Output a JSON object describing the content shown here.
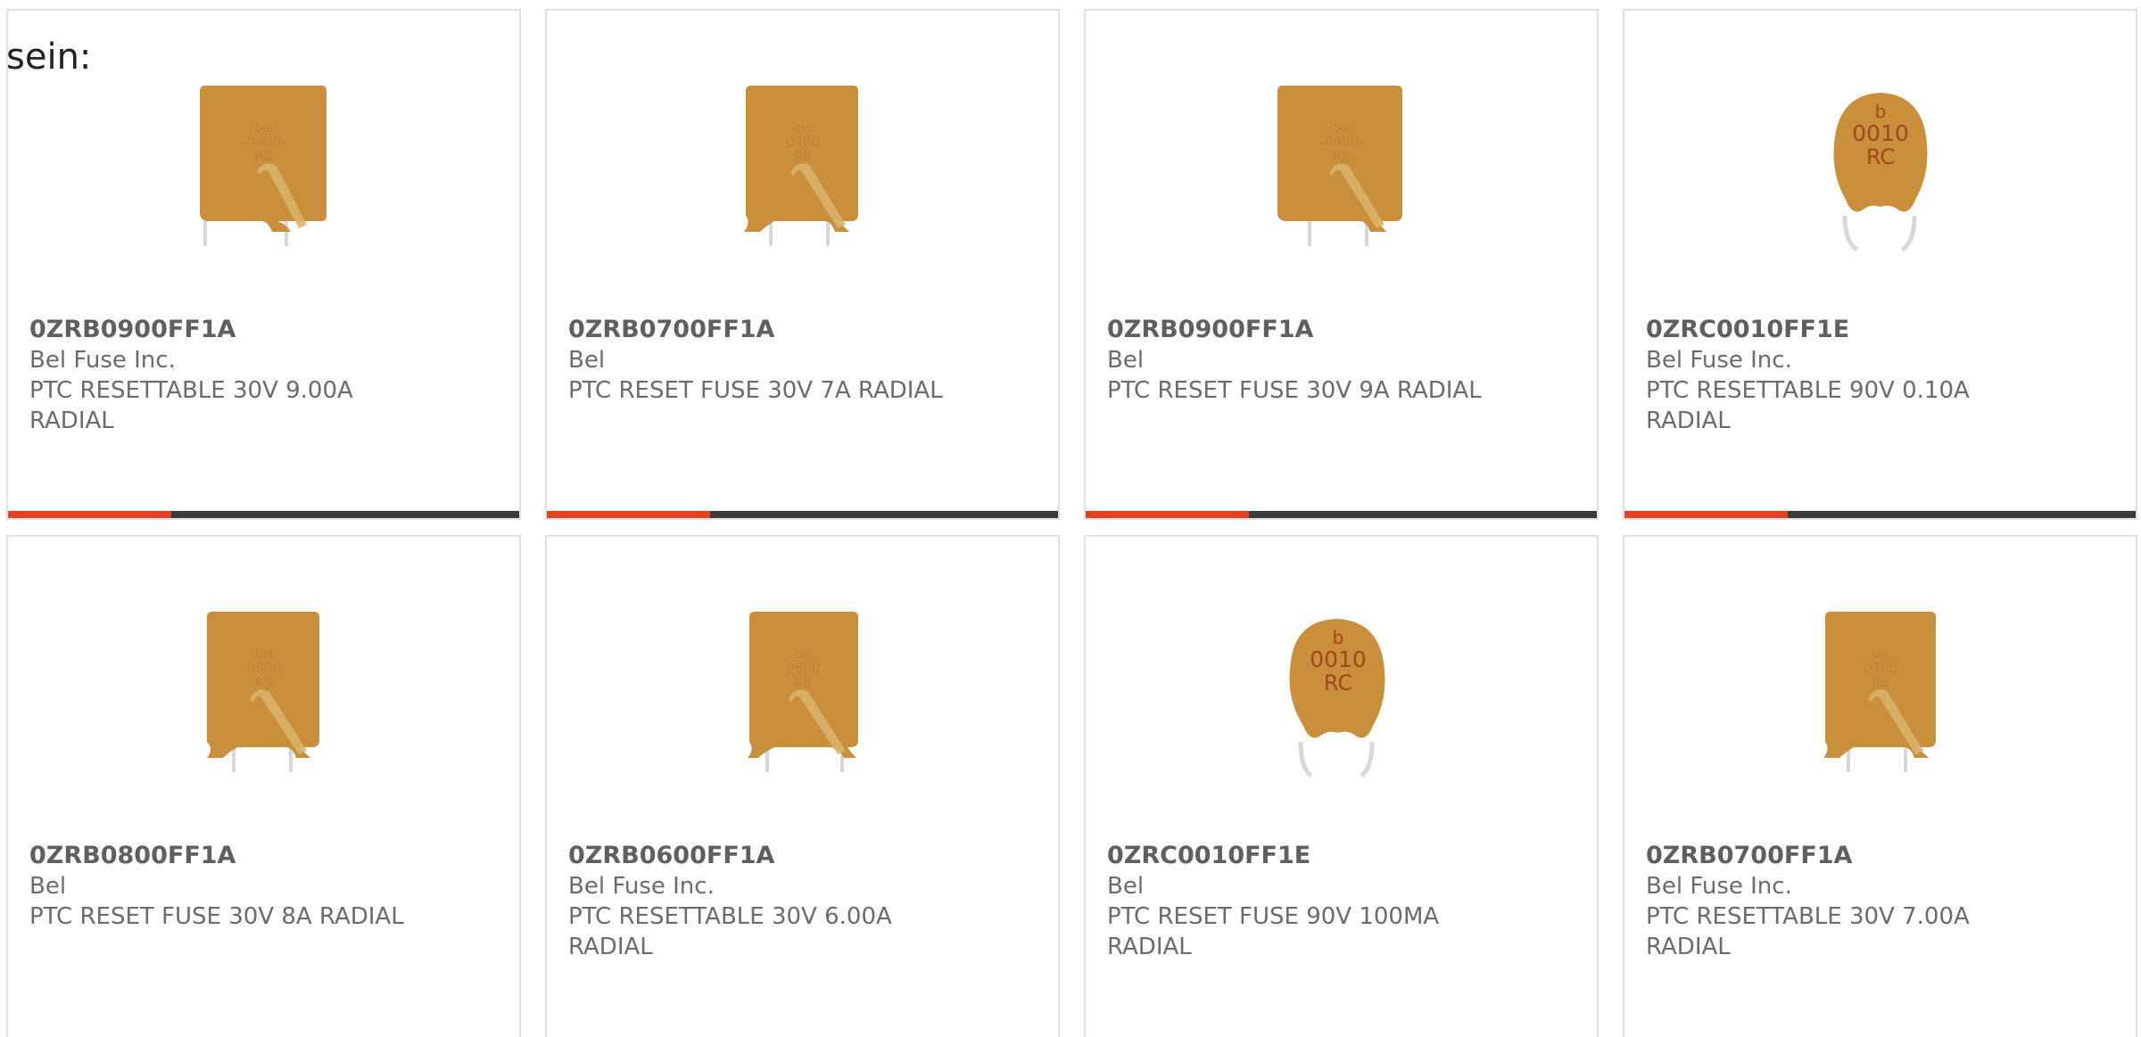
{
  "intro": {
    "text": "sein:"
  },
  "theme": {
    "accent": "#e7411d",
    "bar_dark": "#3b3b3b",
    "card_border": "#e0e0e0",
    "text_dark": "#5f5f5f",
    "text_muted": "#6b6b6b",
    "fuse_body": "#c98f3a"
  },
  "products": [
    {
      "part_number": "0ZRB0900FF1A",
      "manufacturer": "Bel Fuse Inc.",
      "description": "PTC RESETTABLE 30V 9.00A RADIAL",
      "image_icon": "rectangular-fuse-icon",
      "image_marking": [
        "bel",
        "0900",
        "RB"
      ],
      "progress": 0.32
    },
    {
      "part_number": "0ZRB0700FF1A",
      "manufacturer": "Bel",
      "description": "PTC RESET FUSE 30V 7A RADIAL",
      "image_icon": "rectangular-fuse-icon",
      "image_marking": [
        "bel",
        "0700",
        "RB"
      ],
      "progress": 0.32
    },
    {
      "part_number": "0ZRB0900FF1A",
      "manufacturer": "Bel",
      "description": "PTC RESET FUSE 30V 9A RADIAL",
      "image_icon": "rectangular-fuse-icon",
      "image_marking": [
        "bel",
        "0900",
        "RB"
      ],
      "progress": 0.32
    },
    {
      "part_number": "0ZRC0010FF1E",
      "manufacturer": "Bel Fuse Inc.",
      "description": "PTC RESETTABLE 90V 0.10A RADIAL",
      "image_icon": "disc-fuse-icon",
      "image_marking": [
        "b",
        "0010",
        "RC"
      ],
      "progress": 0.32
    },
    {
      "part_number": "0ZRB0800FF1A",
      "manufacturer": "Bel",
      "description": "PTC RESET FUSE 30V 8A RADIAL",
      "image_icon": "rectangular-fuse-icon",
      "image_marking": [
        "bel",
        "0800",
        "RB"
      ],
      "progress": 0.32
    },
    {
      "part_number": "0ZRB0600FF1A",
      "manufacturer": "Bel Fuse Inc.",
      "description": "PTC RESETTABLE 30V 6.00A RADIAL",
      "image_icon": "rectangular-fuse-icon",
      "image_marking": [
        "bel",
        "0600",
        "RB"
      ],
      "progress": 0.32
    },
    {
      "part_number": "0ZRC0010FF1E",
      "manufacturer": "Bel",
      "description": "PTC RESET FUSE 90V 100MA RADIAL",
      "image_icon": "disc-fuse-icon",
      "image_marking": [
        "b",
        "0010",
        "RC"
      ],
      "progress": 0.32
    },
    {
      "part_number": "0ZRB0700FF1A",
      "manufacturer": "Bel Fuse Inc.",
      "description": "PTC RESETTABLE 30V 7.00A RADIAL",
      "image_icon": "rectangular-fuse-icon",
      "image_marking": [
        "bel",
        "0700",
        "RB"
      ],
      "progress": 0.32
    }
  ]
}
